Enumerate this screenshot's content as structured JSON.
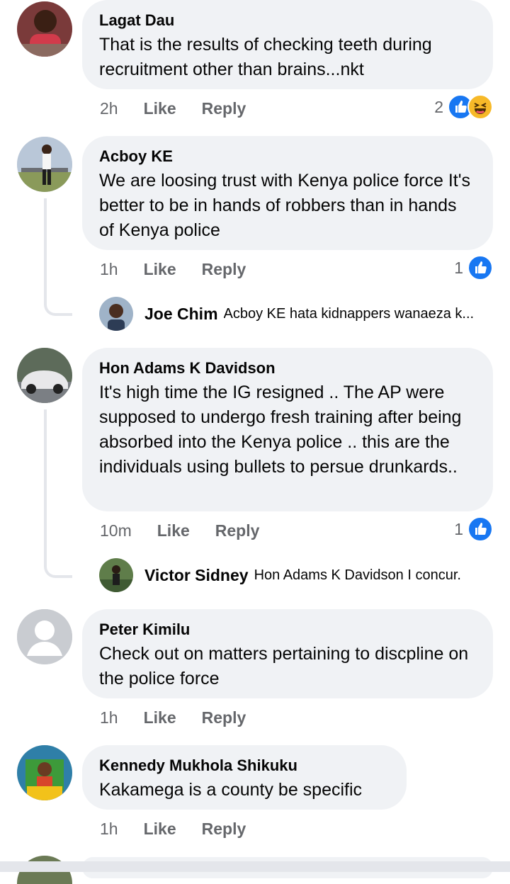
{
  "comments": [
    {
      "author": "Lagat Dau",
      "text": "That is the results of checking teeth during recruitment other than brains...nkt",
      "time": "2h",
      "like_label": "Like",
      "reply_label": "Reply",
      "reaction_count": "2",
      "reactions": [
        "like-icon",
        "haha-icon"
      ]
    },
    {
      "author": "Acboy KE",
      "text": "We are loosing trust with Kenya police force It's better to be in hands of robbers than in hands of Kenya police",
      "time": "1h",
      "like_label": "Like",
      "reply_label": "Reply",
      "reaction_count": "1",
      "reactions": [
        "like-icon"
      ],
      "reply": {
        "author": "Joe Chim",
        "text": "Acboy KE hata kidnappers wanaeza k..."
      }
    },
    {
      "author": "Hon Adams K Davidson",
      "text": "It's high time the IG resigned .. The AP were supposed to undergo fresh training after being absorbed into the Kenya police .. this are the individuals using bullets to persue drunkards..",
      "time": "10m",
      "like_label": "Like",
      "reply_label": "Reply",
      "reaction_count": "1",
      "reactions": [
        "like-icon"
      ],
      "reply": {
        "author": "Victor Sidney",
        "text": "Hon Adams K Davidson I concur."
      }
    },
    {
      "author": "Peter Kimilu",
      "text": "Check out on matters pertaining to discpline on the police force",
      "time": "1h",
      "like_label": "Like",
      "reply_label": "Reply"
    },
    {
      "author": "Kennedy Mukhola Shikuku",
      "text": "Kakamega is a county be specific",
      "time": "1h",
      "like_label": "Like",
      "reply_label": "Reply"
    }
  ],
  "colors": {
    "like_blue": "#1877f2",
    "haha_yellow": "#f7b928",
    "bubble_bg": "#f0f2f5",
    "meta_gray": "#65676b"
  }
}
